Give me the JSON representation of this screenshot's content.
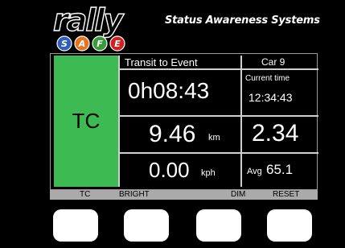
{
  "header": {
    "logo_word": "rally",
    "logo_letters": [
      "S",
      "A",
      "F",
      "E"
    ],
    "tagline": "Status Awareness Systems"
  },
  "screen": {
    "mode": "TC",
    "stage_label": "Transit to Event",
    "car_label": "Car 9",
    "elapsed_time": "0h08:43",
    "current_time_label": "Current time",
    "current_time": "12:34:43",
    "distance_value": "9.46",
    "distance_unit": "km",
    "right_value": "2.34",
    "speed_value": "0.00",
    "speed_unit": "kph",
    "avg_label": "Avg",
    "avg_value": "65.1"
  },
  "softkeys": {
    "labels": [
      "TC",
      "BRIGHT",
      "DIM",
      "RESET"
    ]
  },
  "colors": {
    "mode_panel": "#3dba52",
    "softbar": "#aaaaaa",
    "background": "#000000",
    "logo_badge_blue": "#2f5fb8",
    "logo_badge_orange": "#e8731e",
    "logo_badge_green": "#3a9a3a",
    "logo_badge_red": "#d02020"
  }
}
